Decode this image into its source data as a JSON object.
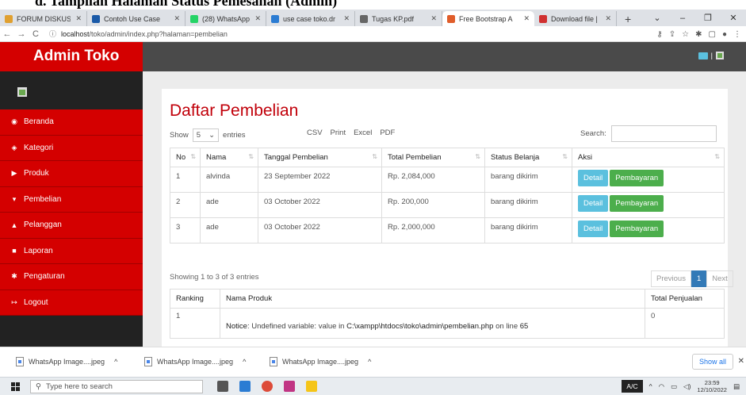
{
  "doc_heading": "d.    Tampilan Halaman Status Pemesanan (Admin)",
  "browser": {
    "tabs": [
      {
        "label": "FORUM DISKUSI",
        "color": "#e0a030"
      },
      {
        "label": "Contoh Use Case",
        "color": "#1a5aa8"
      },
      {
        "label": "(28) WhatsApp",
        "color": "#25d366"
      },
      {
        "label": "use case toko.dr",
        "color": "#2b7cd3"
      },
      {
        "label": "Tugas KP.pdf",
        "color": "#666666"
      },
      {
        "label": "Free Bootstrap A",
        "color": "#e05d2a"
      },
      {
        "label": "Download file |",
        "color": "#d03030"
      }
    ],
    "active_tab_index": 5,
    "url_host": "localhost",
    "url_path": "/toko/admin/index.php?halaman=pembelian"
  },
  "app": {
    "brand": "Admin Toko",
    "accent_color": "#d40000"
  },
  "sidebar": {
    "items": [
      {
        "label": "Beranda",
        "icon": "dashboard-icon",
        "glyph": "◉"
      },
      {
        "label": "Kategori",
        "icon": "tag-icon",
        "glyph": "◈"
      },
      {
        "label": "Produk",
        "icon": "tag-icon",
        "glyph": "▶"
      },
      {
        "label": "Pembelian",
        "icon": "cart-icon",
        "glyph": "▾"
      },
      {
        "label": "Pelanggan",
        "icon": "user-icon",
        "glyph": "▲"
      },
      {
        "label": "Laporan",
        "icon": "file-icon",
        "glyph": "■"
      },
      {
        "label": "Pengaturan",
        "icon": "gear-icon",
        "glyph": "✱"
      },
      {
        "label": "Logout",
        "icon": "logout-icon",
        "glyph": "↦"
      }
    ]
  },
  "main": {
    "title": "Daftar Pembelian",
    "show_label": "Show",
    "show_value": "5",
    "entries_label": "entries",
    "export_buttons": [
      "CSV",
      "Print",
      "Excel",
      "PDF"
    ],
    "search_label": "Search:",
    "search_value": "",
    "columns": [
      "No",
      "Nama",
      "Tanggal Pembelian",
      "Total Pembelian",
      "Status Belanja",
      "Aksi"
    ],
    "rows": [
      {
        "no": "1",
        "nama": "alvinda",
        "tanggal": "23 September 2022",
        "total": "Rp. 2,084,000",
        "status": "barang dikirim",
        "detail": "Detail",
        "bayar": "Pembayaran"
      },
      {
        "no": "2",
        "nama": "ade",
        "tanggal": "03 October 2022",
        "total": "Rp. 200,000",
        "status": "barang dikirim",
        "detail": "Detail",
        "bayar": "Pembayaran"
      },
      {
        "no": "3",
        "nama": "ade",
        "tanggal": "03 October 2022",
        "total": "Rp. 2,000,000",
        "status": "barang dikirim",
        "detail": "Detail",
        "bayar": "Pembayaran"
      }
    ],
    "info": "Showing 1 to 3 of 3 entries",
    "pager": {
      "prev": "Previous",
      "current": "1",
      "next": "Next"
    },
    "rank_columns": [
      "Ranking",
      "Nama Produk",
      "Total Penjualan"
    ],
    "rank_row": {
      "ranking": "1",
      "notice_label": "Notice",
      "notice_text": ": Undefined variable: value in ",
      "notice_path": "C:\\xampp\\htdocs\\toko\\admin\\pembelian.php",
      "notice_line_label": " on line ",
      "notice_line": "65",
      "total": "0"
    }
  },
  "downloads": {
    "items": [
      "WhatsApp Image....jpeg",
      "WhatsApp Image....jpeg",
      "WhatsApp Image....jpeg"
    ],
    "show_all": "Show all"
  },
  "taskbar": {
    "search_placeholder": "Type here to search",
    "ime": "A/C",
    "time": "23:59",
    "date": "12/10/2022"
  }
}
